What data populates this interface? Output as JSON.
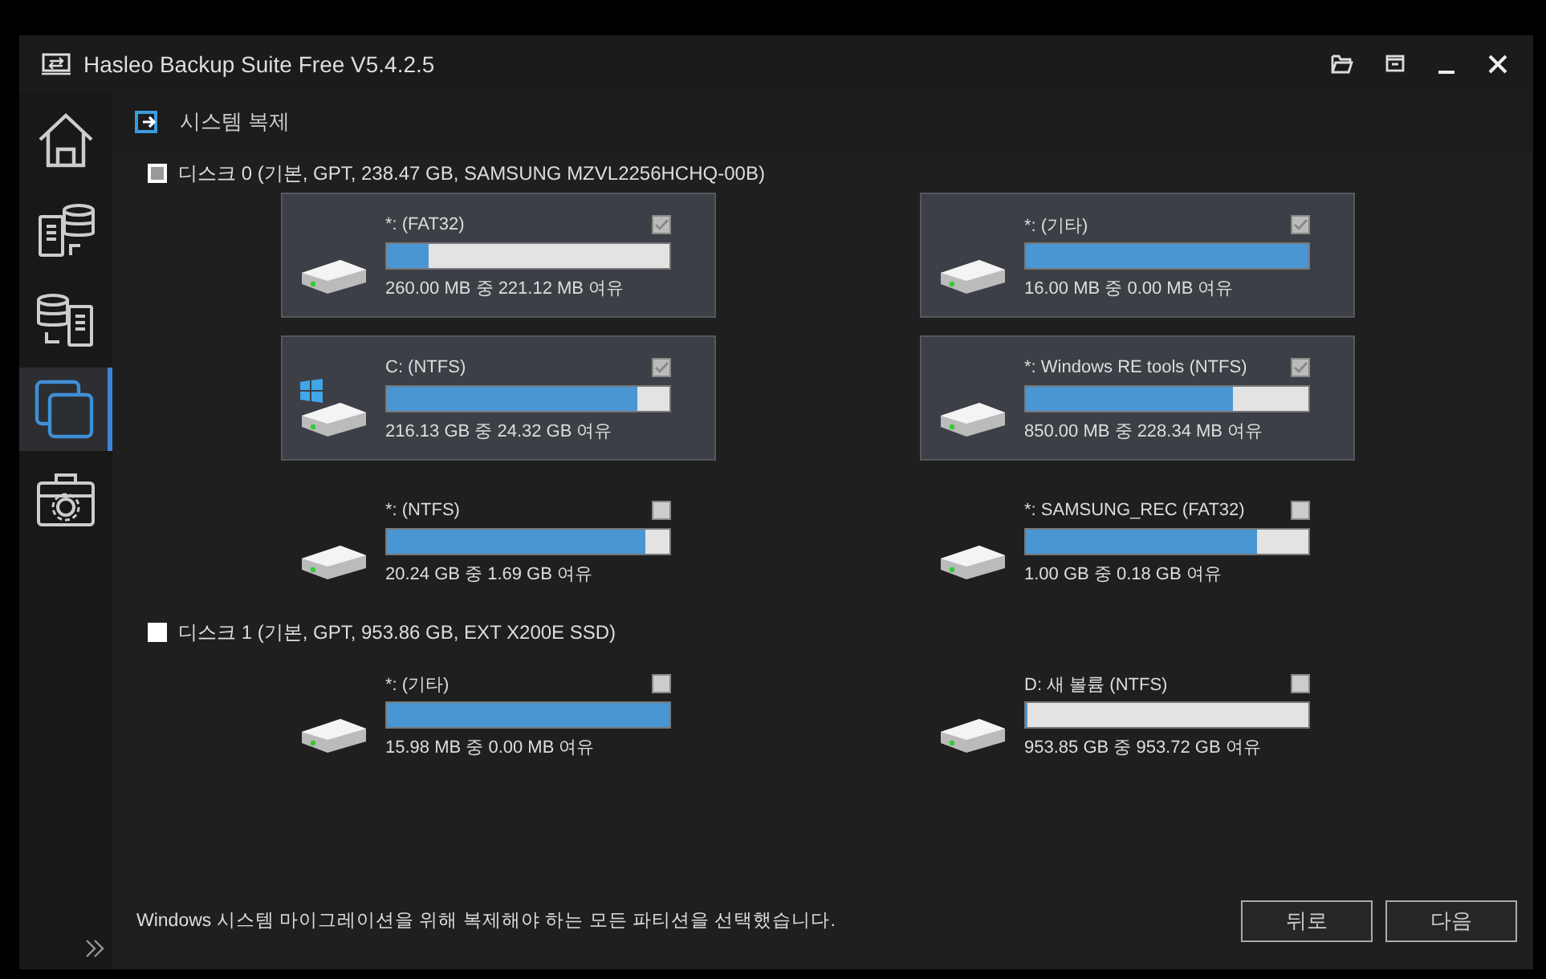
{
  "window": {
    "title": "Hasleo Backup Suite Free V5.4.2.5"
  },
  "sidebar": {
    "items": [
      {
        "kind": "home",
        "selected": false
      },
      {
        "kind": "backup",
        "selected": false
      },
      {
        "kind": "restore",
        "selected": false
      },
      {
        "kind": "clone",
        "selected": true
      },
      {
        "kind": "tools",
        "selected": false
      }
    ]
  },
  "page": {
    "title": "시스템 복제"
  },
  "disks": [
    {
      "label": "디스크 0 (기본, GPT, 238.47 GB,  SAMSUNG MZVL2256HCHQ-00B)",
      "checked": false,
      "partial": true,
      "partitions": [
        {
          "name": "*: (FAT32)",
          "free": "260.00 MB 중 221.12 MB 여유",
          "level": 0.15,
          "checked": true,
          "system": false
        },
        {
          "name": "*: (기타)",
          "free": "16.00 MB 중 0.00 MB 여유",
          "level": 1,
          "checked": true,
          "system": false
        },
        {
          "name": "C: (NTFS)",
          "free": "216.13 GB 중 24.32 GB 여유",
          "level": 0.887,
          "checked": true,
          "system": true
        },
        {
          "name": "*: Windows RE tools (NTFS)",
          "free": "850.00 MB 중 228.34 MB 여유",
          "level": 0.731,
          "checked": true,
          "system": false
        },
        {
          "name": "*: (NTFS)",
          "free": "20.24 GB 중 1.69 GB 여유",
          "level": 0.917,
          "checked": false,
          "system": false
        },
        {
          "name": "*: SAMSUNG_REC (FAT32)",
          "free": "1.00 GB 중 0.18 GB 여유",
          "level": 0.82,
          "checked": false,
          "system": false
        }
      ]
    },
    {
      "label": "디스크 1 (기본, GPT, 953.86 GB,  EXT X200E SSD)",
      "checked": false,
      "partial": false,
      "partitions": [
        {
          "name": "*: (기타)",
          "free": "15.98 MB 중 0.00 MB 여유",
          "level": 1,
          "checked": false,
          "system": false
        },
        {
          "name": "D: 새 볼륨 (NTFS)",
          "free": "953.85 GB 중 953.72 GB 여유",
          "level": 0.005,
          "checked": false,
          "system": false
        }
      ]
    }
  ],
  "status": {
    "message": "Windows 시스템 마이그레이션을 위해 복제해야 하는 모든 파티션을 선택했습니다."
  },
  "buttons": [
    "뒤로",
    "다음"
  ]
}
